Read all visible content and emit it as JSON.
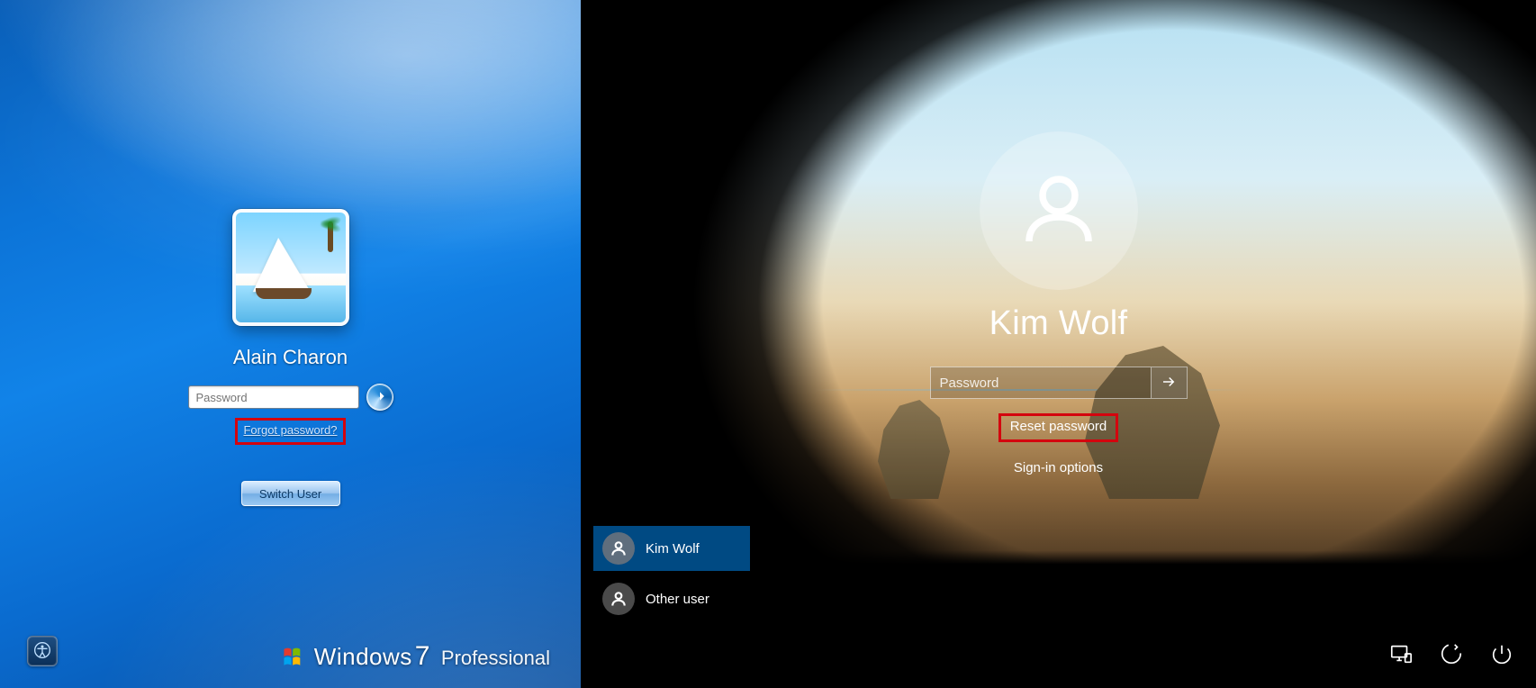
{
  "win7": {
    "username": "Alain Charon",
    "password_placeholder": "Password",
    "forgot_label": "Forgot password?",
    "switch_user_label": "Switch User",
    "brand_word1": "Windows",
    "brand_seven": "7",
    "brand_word2": "Professional",
    "ease_icon": "ease-of-access-icon",
    "go_icon": "arrow-right-icon",
    "avatar_desc": "sailboat-beach-avatar",
    "highlight_color": "#d4040e"
  },
  "win10": {
    "username": "Kim Wolf",
    "password_placeholder": "Password",
    "reset_label": "Reset password",
    "signin_options_label": "Sign-in options",
    "users": [
      {
        "name": "Kim Wolf",
        "selected": true
      },
      {
        "name": "Other user",
        "selected": false
      }
    ],
    "tray": {
      "network_icon": "network-icon",
      "ease_icon": "ease-of-access-icon",
      "power_icon": "power-icon"
    },
    "submit_icon": "arrow-right-icon",
    "highlight_color": "#d4040e"
  }
}
